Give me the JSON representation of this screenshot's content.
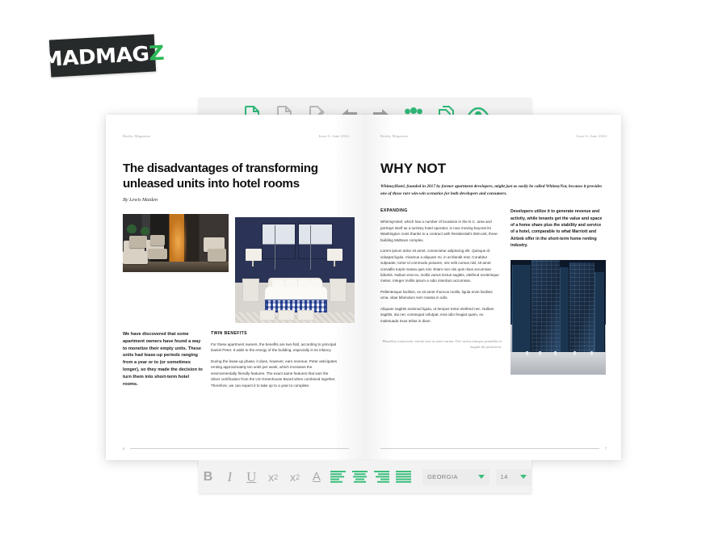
{
  "brand": {
    "name": "MADMAG",
    "accent_letter": "Z",
    "accent_color": "#2cb757"
  },
  "top_toolbar": {
    "buttons": [
      {
        "name": "add-page-icon",
        "label": "Add page",
        "color": "#2fb978"
      },
      {
        "name": "delete-page-icon",
        "label": "Delete page",
        "color": "#b9b9b9"
      },
      {
        "name": "edit-page-icon",
        "label": "Edit page",
        "color": "#b9b9b9"
      },
      {
        "name": "arrow-left-icon",
        "label": "Previous page",
        "color": "#a3a3a3"
      },
      {
        "name": "arrow-right-icon",
        "label": "Next page",
        "color": "#a3a3a3"
      },
      {
        "name": "team-icon",
        "label": "Team",
        "color": "#2fb978"
      },
      {
        "name": "export-page-icon",
        "label": "Export",
        "color": "#2fb978"
      },
      {
        "name": "preview-eye-icon",
        "label": "Preview",
        "color": "#2fb978"
      }
    ]
  },
  "bottom_toolbar": {
    "format_buttons": [
      {
        "name": "bold-button",
        "label": "B",
        "color": "#a8a8a8"
      },
      {
        "name": "italic-button",
        "label": "I",
        "color": "#a8a8a8"
      },
      {
        "name": "underline-button",
        "label": "U",
        "color": "#a8a8a8"
      },
      {
        "name": "superscript-button",
        "label": "x",
        "sub": "2",
        "color": "#a8a8a8"
      },
      {
        "name": "subscript-button",
        "label": "x",
        "sub": "2",
        "color": "#a8a8a8"
      },
      {
        "name": "text-color-button",
        "label": "A",
        "color": "#a8a8a8"
      }
    ],
    "align_buttons": [
      {
        "name": "align-left-button",
        "label": "Align left",
        "color": "#3bbf7c"
      },
      {
        "name": "align-center-button",
        "label": "Align center",
        "color": "#3bbf7c"
      },
      {
        "name": "align-right-button",
        "label": "Align right",
        "color": "#3bbf7c"
      },
      {
        "name": "align-justify-button",
        "label": "Justify",
        "color": "#3bbf7c"
      }
    ],
    "font_family": {
      "value": "GEORGIA"
    },
    "font_size": {
      "value": "14"
    }
  },
  "left_page": {
    "header_left": "Realty Magazine",
    "header_right": "Issue 6, June 2024",
    "title": "The disadvantages of transforming unleased units into hotel rooms",
    "byline": "By Lewis Maiden",
    "images": [
      {
        "name": "hotel-lobby-photo",
        "alt": "Hotel lobby with armchairs"
      },
      {
        "name": "hotel-bedroom-photo",
        "alt": "Hotel bedroom with blue checked bed"
      }
    ],
    "lead": "We have discovered that some apartment owners have found a way to monetize their empty units. These units had lease-up periods ranging from a year or to (or sometimes longer), so they made the decision to turn them into short-term hotel rooms.",
    "section_heading": "TWIN BENEFITS",
    "paragraphs": [
      "For these apartment owners, the benefits are two-fold, according to principal Daniel Peter. It adds to the energy of the building, especially in its infancy.",
      "During the lease-up phase, it does, however, earn revenue. Peter anticipates renting approximately ten units per week, which increases the environmentally friendly features. The exact same features that won the Silver certification from the US Greenhouse Board when combined together. Therefore, we can expect it to take up to a year to complete."
    ],
    "page_number": "6"
  },
  "right_page": {
    "header_left": "Realty Magazine",
    "header_right": "Issue 6, June 2024",
    "title": "WHY NOT",
    "standfirst": "WhimsyHotel, founded in 2017 by former apartment developers, might just as easily be called WhimsyNot, because it provides one of those rare win-win scenarios for both developers and consumers.",
    "section_heading": "EXPANDING",
    "paragraphs": [
      "WhimsyHotel, which has a number of locations in the D.C. area and portrays itself as a turnkey hotel operator, is now moving beyond its Washington roots thanks to a contract with Residential's 550-unit, three-building Midtown complex.",
      "Lorem ipsum dolor sit amet, consectetur adipiscing elit. Quisque id volutpat ligula. Vivamus a aliquam mi, in at blandit erat. Curabitur vulputate, tortor id commodo posuere, nisi velit cursus nisl, sit amet convallis turpis massa quis nisi. Etiam non nisi quis risus accumsan lobortis. Nullam erat ex, mollis varius lectus sagittis, eleifend scelerisque metus. Integer mollis ipsum a odio interdum accumsan.",
      "Pellentesque facilisis, ex sit amet rhoncus mollis, ligula enim facilisis urna, vitae bibendum sem massa in odio.",
      "Aliquam sagittis euismod ligula, ut tempus tortor eleifend nec. Nullam sagittis, dui nec consequat volutpat, erat odio feugiat quam, eu malesuada risus tellus in diam."
    ],
    "pull_quote": "Developers utilize it to generate revenue and activity, while tenants get the value and space of a home share plus the stability and service of a hotel, comparable to what Marriott and Airbnb offer in the short-term home renting industry.",
    "image": {
      "name": "glass-tower-photo",
      "alt": "Modern blue glass office tower"
    },
    "caption": "Phasellus consectetur rutrum sem sit amet rutrum. Orci varius natoque penatibus et magnis dis parturient.",
    "page_number": "7"
  }
}
